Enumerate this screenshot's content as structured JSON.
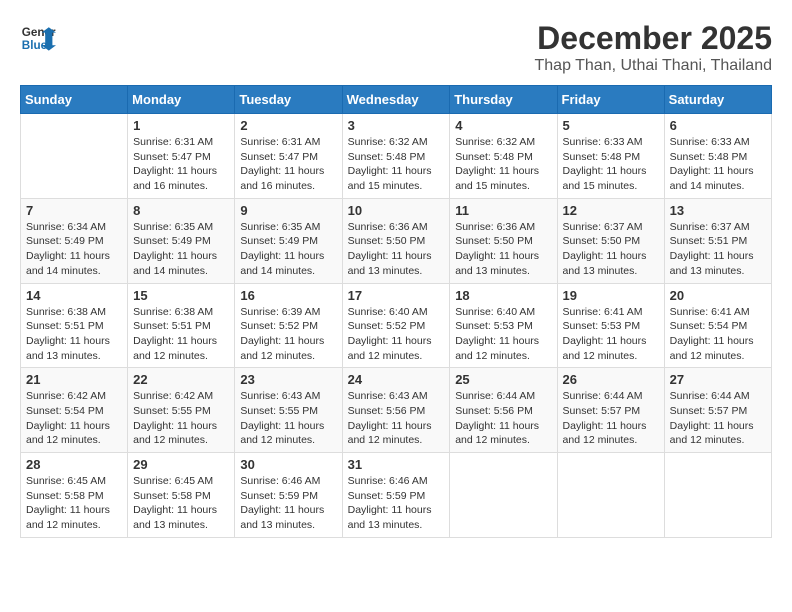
{
  "header": {
    "logo_line1": "General",
    "logo_line2": "Blue",
    "month_year": "December 2025",
    "location": "Thap Than, Uthai Thani, Thailand"
  },
  "weekdays": [
    "Sunday",
    "Monday",
    "Tuesday",
    "Wednesday",
    "Thursday",
    "Friday",
    "Saturday"
  ],
  "weeks": [
    [
      {
        "day": "",
        "sunrise": "",
        "sunset": "",
        "daylight": ""
      },
      {
        "day": "1",
        "sunrise": "Sunrise: 6:31 AM",
        "sunset": "Sunset: 5:47 PM",
        "daylight": "Daylight: 11 hours and 16 minutes."
      },
      {
        "day": "2",
        "sunrise": "Sunrise: 6:31 AM",
        "sunset": "Sunset: 5:47 PM",
        "daylight": "Daylight: 11 hours and 16 minutes."
      },
      {
        "day": "3",
        "sunrise": "Sunrise: 6:32 AM",
        "sunset": "Sunset: 5:48 PM",
        "daylight": "Daylight: 11 hours and 15 minutes."
      },
      {
        "day": "4",
        "sunrise": "Sunrise: 6:32 AM",
        "sunset": "Sunset: 5:48 PM",
        "daylight": "Daylight: 11 hours and 15 minutes."
      },
      {
        "day": "5",
        "sunrise": "Sunrise: 6:33 AM",
        "sunset": "Sunset: 5:48 PM",
        "daylight": "Daylight: 11 hours and 15 minutes."
      },
      {
        "day": "6",
        "sunrise": "Sunrise: 6:33 AM",
        "sunset": "Sunset: 5:48 PM",
        "daylight": "Daylight: 11 hours and 14 minutes."
      }
    ],
    [
      {
        "day": "7",
        "sunrise": "Sunrise: 6:34 AM",
        "sunset": "Sunset: 5:49 PM",
        "daylight": "Daylight: 11 hours and 14 minutes."
      },
      {
        "day": "8",
        "sunrise": "Sunrise: 6:35 AM",
        "sunset": "Sunset: 5:49 PM",
        "daylight": "Daylight: 11 hours and 14 minutes."
      },
      {
        "day": "9",
        "sunrise": "Sunrise: 6:35 AM",
        "sunset": "Sunset: 5:49 PM",
        "daylight": "Daylight: 11 hours and 14 minutes."
      },
      {
        "day": "10",
        "sunrise": "Sunrise: 6:36 AM",
        "sunset": "Sunset: 5:50 PM",
        "daylight": "Daylight: 11 hours and 13 minutes."
      },
      {
        "day": "11",
        "sunrise": "Sunrise: 6:36 AM",
        "sunset": "Sunset: 5:50 PM",
        "daylight": "Daylight: 11 hours and 13 minutes."
      },
      {
        "day": "12",
        "sunrise": "Sunrise: 6:37 AM",
        "sunset": "Sunset: 5:50 PM",
        "daylight": "Daylight: 11 hours and 13 minutes."
      },
      {
        "day": "13",
        "sunrise": "Sunrise: 6:37 AM",
        "sunset": "Sunset: 5:51 PM",
        "daylight": "Daylight: 11 hours and 13 minutes."
      }
    ],
    [
      {
        "day": "14",
        "sunrise": "Sunrise: 6:38 AM",
        "sunset": "Sunset: 5:51 PM",
        "daylight": "Daylight: 11 hours and 13 minutes."
      },
      {
        "day": "15",
        "sunrise": "Sunrise: 6:38 AM",
        "sunset": "Sunset: 5:51 PM",
        "daylight": "Daylight: 11 hours and 12 minutes."
      },
      {
        "day": "16",
        "sunrise": "Sunrise: 6:39 AM",
        "sunset": "Sunset: 5:52 PM",
        "daylight": "Daylight: 11 hours and 12 minutes."
      },
      {
        "day": "17",
        "sunrise": "Sunrise: 6:40 AM",
        "sunset": "Sunset: 5:52 PM",
        "daylight": "Daylight: 11 hours and 12 minutes."
      },
      {
        "day": "18",
        "sunrise": "Sunrise: 6:40 AM",
        "sunset": "Sunset: 5:53 PM",
        "daylight": "Daylight: 11 hours and 12 minutes."
      },
      {
        "day": "19",
        "sunrise": "Sunrise: 6:41 AM",
        "sunset": "Sunset: 5:53 PM",
        "daylight": "Daylight: 11 hours and 12 minutes."
      },
      {
        "day": "20",
        "sunrise": "Sunrise: 6:41 AM",
        "sunset": "Sunset: 5:54 PM",
        "daylight": "Daylight: 11 hours and 12 minutes."
      }
    ],
    [
      {
        "day": "21",
        "sunrise": "Sunrise: 6:42 AM",
        "sunset": "Sunset: 5:54 PM",
        "daylight": "Daylight: 11 hours and 12 minutes."
      },
      {
        "day": "22",
        "sunrise": "Sunrise: 6:42 AM",
        "sunset": "Sunset: 5:55 PM",
        "daylight": "Daylight: 11 hours and 12 minutes."
      },
      {
        "day": "23",
        "sunrise": "Sunrise: 6:43 AM",
        "sunset": "Sunset: 5:55 PM",
        "daylight": "Daylight: 11 hours and 12 minutes."
      },
      {
        "day": "24",
        "sunrise": "Sunrise: 6:43 AM",
        "sunset": "Sunset: 5:56 PM",
        "daylight": "Daylight: 11 hours and 12 minutes."
      },
      {
        "day": "25",
        "sunrise": "Sunrise: 6:44 AM",
        "sunset": "Sunset: 5:56 PM",
        "daylight": "Daylight: 11 hours and 12 minutes."
      },
      {
        "day": "26",
        "sunrise": "Sunrise: 6:44 AM",
        "sunset": "Sunset: 5:57 PM",
        "daylight": "Daylight: 11 hours and 12 minutes."
      },
      {
        "day": "27",
        "sunrise": "Sunrise: 6:44 AM",
        "sunset": "Sunset: 5:57 PM",
        "daylight": "Daylight: 11 hours and 12 minutes."
      }
    ],
    [
      {
        "day": "28",
        "sunrise": "Sunrise: 6:45 AM",
        "sunset": "Sunset: 5:58 PM",
        "daylight": "Daylight: 11 hours and 12 minutes."
      },
      {
        "day": "29",
        "sunrise": "Sunrise: 6:45 AM",
        "sunset": "Sunset: 5:58 PM",
        "daylight": "Daylight: 11 hours and 13 minutes."
      },
      {
        "day": "30",
        "sunrise": "Sunrise: 6:46 AM",
        "sunset": "Sunset: 5:59 PM",
        "daylight": "Daylight: 11 hours and 13 minutes."
      },
      {
        "day": "31",
        "sunrise": "Sunrise: 6:46 AM",
        "sunset": "Sunset: 5:59 PM",
        "daylight": "Daylight: 11 hours and 13 minutes."
      },
      {
        "day": "",
        "sunrise": "",
        "sunset": "",
        "daylight": ""
      },
      {
        "day": "",
        "sunrise": "",
        "sunset": "",
        "daylight": ""
      },
      {
        "day": "",
        "sunrise": "",
        "sunset": "",
        "daylight": ""
      }
    ]
  ]
}
